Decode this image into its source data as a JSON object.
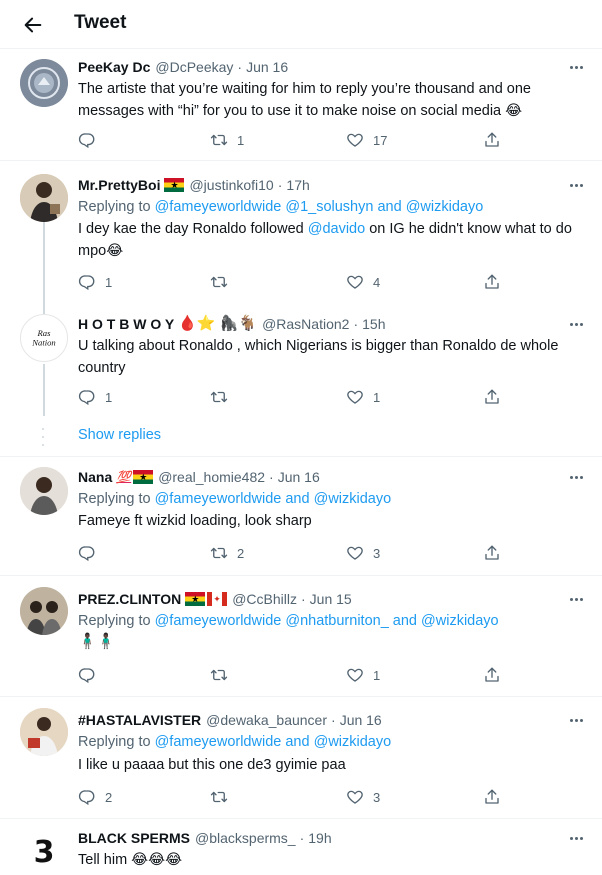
{
  "header": {
    "title": "Tweet"
  },
  "tweets": [
    {
      "name": "PeeKay Dc",
      "handle": "@DcPeekay",
      "time": "Jun 16",
      "body": "The artiste that you’re waiting for him to reply you’re thousand and one messages with “hi” for you to use it to make noise on social media 😂",
      "reply_count": "",
      "retweet_count": "1",
      "like_count": "17"
    },
    {
      "name": "Mr.PrettyBoi",
      "handle": "@justinkofi10",
      "time": "17h",
      "replying_prefix": "Replying to",
      "replying_to": [
        "@fameyeworldwide",
        "@1_solushyn",
        "and",
        "@wizkidayo"
      ],
      "body_parts": [
        "I dey kae the day Ronaldo followed ",
        "@davido",
        " on IG he didn't know what to do mpo😂"
      ],
      "reply_count": "1",
      "retweet_count": "",
      "like_count": "4"
    },
    {
      "name": "H O T B W O Y",
      "name_emoji": "🩸⭐ 🦍🐐",
      "handle": "@RasNation2",
      "time": "15h",
      "body": "U talking about Ronaldo , which Nigerians is bigger than Ronaldo de whole country",
      "reply_count": "1",
      "retweet_count": "",
      "like_count": "1"
    },
    {
      "name": "Nana",
      "name_emoji": "💯",
      "handle": "@real_homie482",
      "time": "Jun 16",
      "replying_prefix": "Replying to",
      "replying_to": [
        "@fameyeworldwide",
        "and",
        "@wizkidayo"
      ],
      "body": "Fameye ft wizkid loading, look sharp",
      "reply_count": "",
      "retweet_count": "2",
      "like_count": "3"
    },
    {
      "name": "PREZ.CLINTON",
      "handle": "@CcBhillz",
      "time": "Jun 15",
      "replying_prefix": "Replying to",
      "replying_to": [
        "@fameyeworldwide",
        "@nhatburniton_",
        "and",
        "@wizkidayo"
      ],
      "body": "🧍🏿‍♂️🧍🏿‍♂️",
      "reply_count": "",
      "retweet_count": "",
      "like_count": "1"
    },
    {
      "name": "#HASTALAVISTER",
      "handle": "@dewaka_bauncer",
      "time": "Jun 16",
      "replying_prefix": "Replying to",
      "replying_to": [
        "@fameyeworldwide",
        "and",
        "@wizkidayo"
      ],
      "body": "I like u paaaa but this one de3 gyimie paa",
      "reply_count": "2",
      "retweet_count": "",
      "like_count": "3"
    },
    {
      "name": "BLACK SPERMS",
      "handle": "@blacksperms_",
      "time": "19h",
      "body": "Tell him 😂😂😂"
    }
  ],
  "show_replies": "Show replies",
  "dot_separator": "·",
  "icons": {
    "back": "arrow-left-icon",
    "more": "more-horizontal-icon",
    "reply": "reply-icon",
    "retweet": "retweet-icon",
    "like": "heart-icon",
    "share": "share-icon"
  },
  "colors": {
    "link": "#1d9bf0",
    "secondary": "#536471",
    "text": "#0f1419",
    "divider": "#eff3f4"
  }
}
